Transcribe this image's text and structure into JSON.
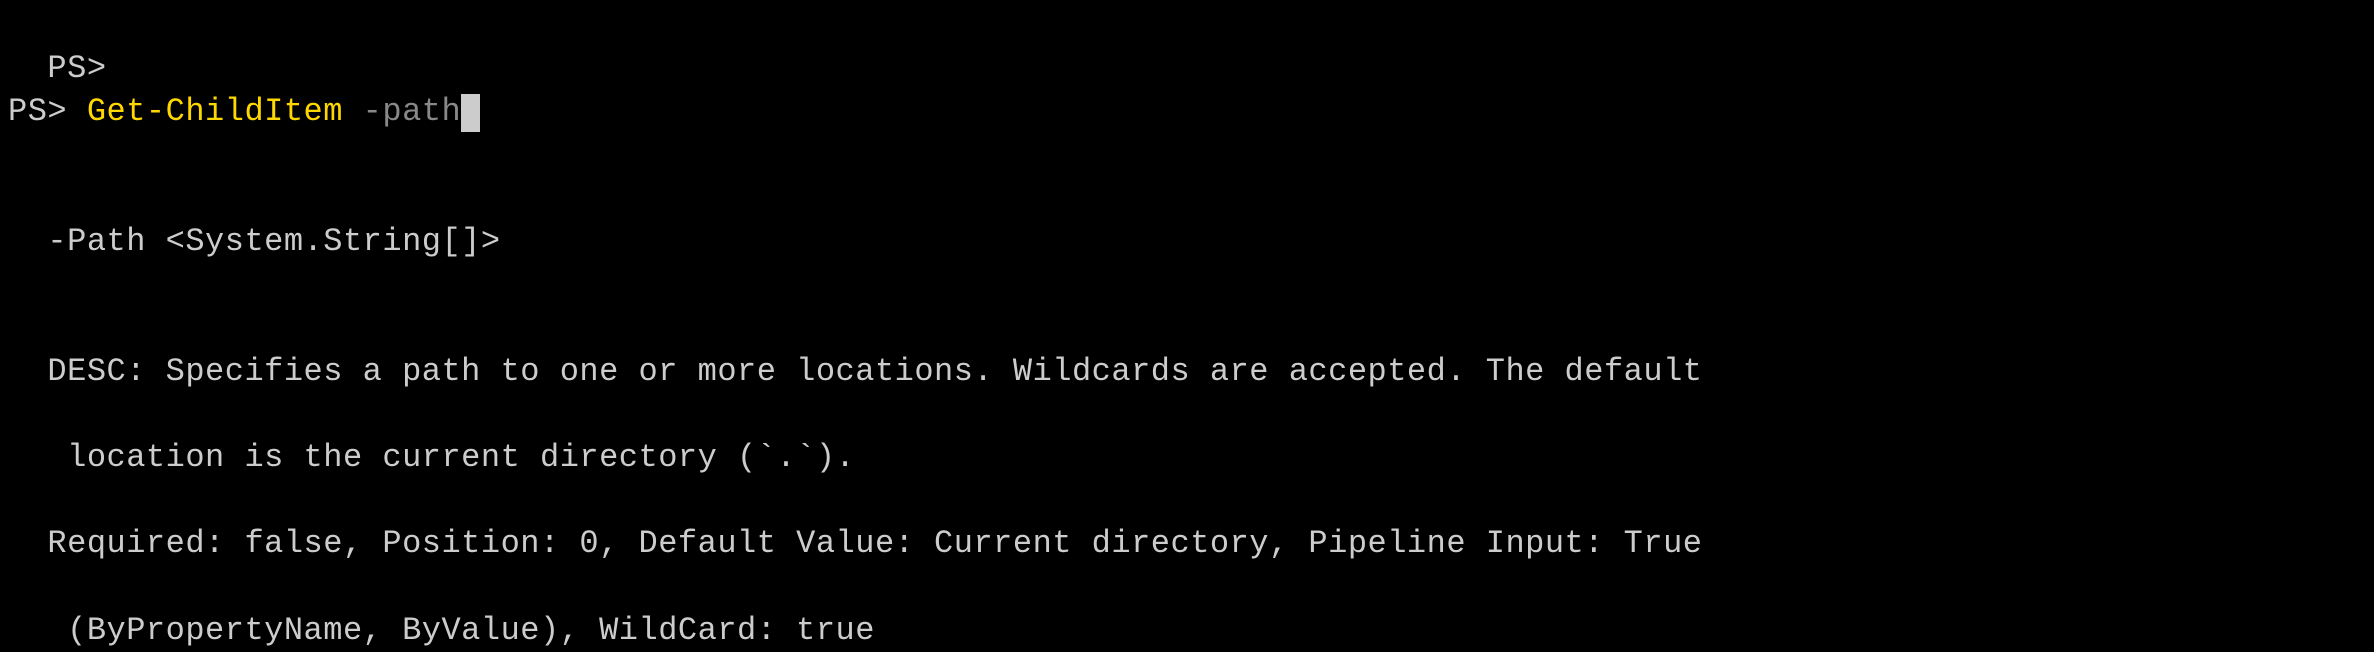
{
  "terminal": {
    "line1_prompt": "PS>",
    "line2_prompt": "PS> ",
    "line2_cmdlet": "Get-ChildItem",
    "line2_space": " ",
    "line2_param": "-path",
    "help": {
      "signature": "-Path <System.String[]>",
      "desc_line1": "DESC: Specifies a path to one or more locations. Wildcards are accepted. The default",
      "desc_line2": " location is the current directory (`.`).",
      "req_line1": "Required: false, Position: 0, Default Value: Current directory, Pipeline Input: True",
      "req_line2": " (ByPropertyName, ByValue), WildCard: true"
    }
  }
}
